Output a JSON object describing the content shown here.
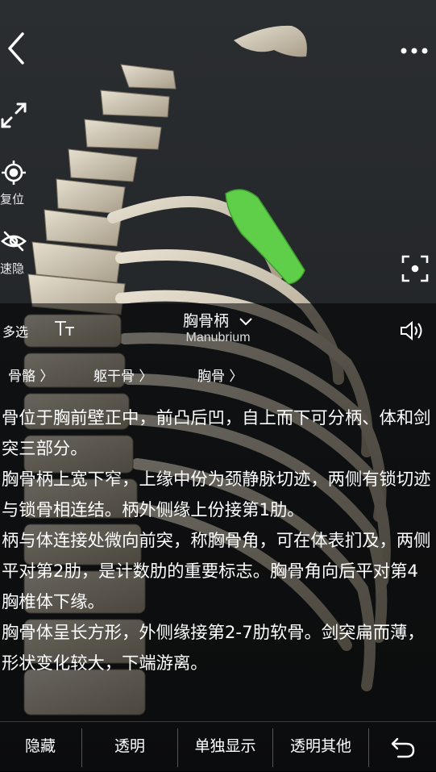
{
  "sidebar": {
    "reset_label": "复位",
    "hide_label": "速隐",
    "multi_label": "多选"
  },
  "panel": {
    "title_cn": "胸骨柄",
    "title_en": "Manubrium",
    "breadcrumb": [
      "骨骼",
      "躯干骨",
      "胸骨"
    ],
    "description": [
      "骨位于胸前壁正中，前凸后凹，自上而下可分柄、体和剑突三部分。",
      "胸骨柄上宽下窄，上缘中份为颈静脉切迹，两侧有锁切迹与锁骨相连结。柄外侧缘上份接第1肋。",
      "柄与体连接处微向前突，称胸骨角，可在体表扪及，两侧平对第2肋，是计数肋的重要标志。胸骨角向后平对第4胸椎体下缘。",
      "胸骨体呈长方形，外侧缘接第2-7肋软骨。剑突扁而薄，形状变化较大，下端游离。"
    ]
  },
  "bottom_bar": {
    "hide": "隐藏",
    "transparent": "透明",
    "isolate": "单独显示",
    "transparent_others": "透明其他"
  },
  "colors": {
    "highlight": "#5fcf4a",
    "bone": "#cfc6b4"
  }
}
